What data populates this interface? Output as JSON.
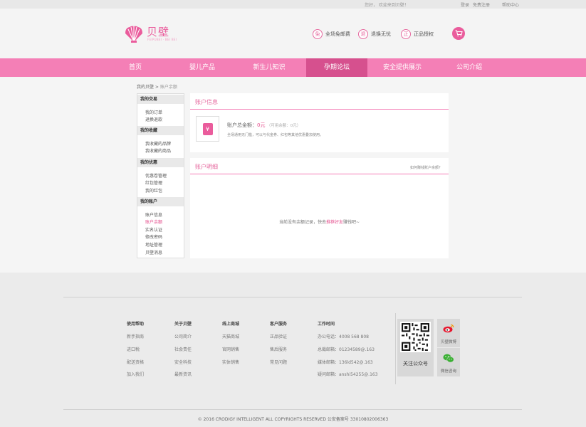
{
  "topbar": {
    "greeting": "您好，   欢迎来到贝壁！",
    "login": "登录",
    "register": "免费注册",
    "help": "帮助中心"
  },
  "brand": {
    "name": "贝壁",
    "subtitle": "FEIPUBEI · BEI BEI"
  },
  "features": [
    {
      "icon": "免",
      "label": "全场免邮费"
    },
    {
      "icon": "退",
      "label": "退换无忧"
    },
    {
      "icon": "正",
      "label": "正品授权"
    }
  ],
  "nav": [
    {
      "label": "首页"
    },
    {
      "label": "婴儿产品"
    },
    {
      "label": "新生儿知识"
    },
    {
      "label": "孕期论坛"
    },
    {
      "label": "安全提供展示"
    },
    {
      "label": "公司介绍"
    }
  ],
  "breadcrumb": {
    "root": "我的贝壁",
    "sep": " > ",
    "current": "账户余额"
  },
  "sidebar": {
    "sections": [
      {
        "title": "我的交易",
        "items": [
          "我的订单",
          "退换退款"
        ]
      },
      {
        "title": "我的收藏",
        "items": [
          "我收藏的品牌",
          "我收藏的商品"
        ]
      },
      {
        "title": "我的优惠",
        "items": [
          "优惠卷管理",
          "红包管理",
          "我的红包"
        ]
      },
      {
        "title": "我的账户",
        "items": [
          "账户信息",
          "账户余额",
          "实名认证",
          "修改密码",
          "地址管理",
          "贝壁消息"
        ]
      }
    ]
  },
  "account": {
    "title": "账户信息",
    "total_label": "账户总金额：",
    "total_value": "0元",
    "available": "（可用余额：0元）",
    "note": "全场通用无门槛，可以与代金券、红包等其他优惠叠加使用。"
  },
  "detail": {
    "title": "账户明细",
    "how": "如何赚钱账户余额？",
    "empty_before": "当前没有余额记录，快去",
    "empty_link": "推荐好友",
    "empty_after": "赚钱吧~"
  },
  "footer": {
    "cols": [
      {
        "title": "使用帮助",
        "links": [
          "新手指南",
          "进口税",
          "配送资格",
          "加入我们"
        ]
      },
      {
        "title": "关于贝壁",
        "links": [
          "公司简介",
          "社会责任",
          "安全科技",
          "最新资讯"
        ]
      },
      {
        "title": "线上商城",
        "links": [
          "天猫商城",
          "官网销售",
          "实体销售"
        ]
      },
      {
        "title": "客户服务",
        "links": [
          "正品验证",
          "售后服务",
          "常见问题"
        ]
      },
      {
        "title": "工作时间",
        "links": [
          "办公电话：4008 568 808",
          "总裁邮箱：01234589@.163",
          "媒体邮箱：136ld542@.163",
          "疑问邮箱：anshi54255@.163"
        ]
      }
    ],
    "qr_label": "关注公众号",
    "weibo_label": "贝壁微博",
    "wechat_label": "微信咨询",
    "copyright": "©  2016  CRODIGY INTELLIGENT ALL COPYRIGHTS RESERVED    公安备案号 33010802006363"
  },
  "colors": {
    "accent": "#ea5c9c",
    "nav": "#f47fb6",
    "nav_active": "#d6508e"
  }
}
